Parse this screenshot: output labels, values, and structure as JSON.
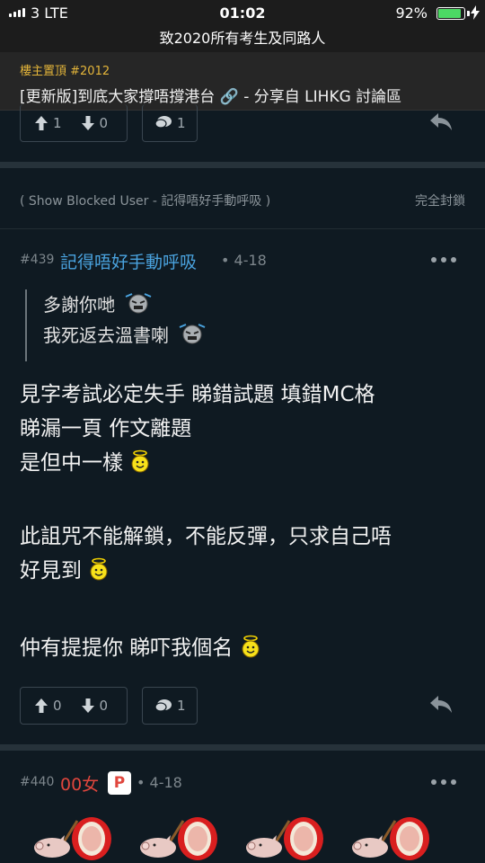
{
  "status": {
    "carrier": "3 LTE",
    "time": "01:02",
    "battery_pct": "92%",
    "battery_level": 0.92
  },
  "header": {
    "title": "致2020所有考生及同路人"
  },
  "pinned": {
    "tag": "樓主置頂 #2012",
    "title": "[更新版]到底大家撐唔撐港台 🔗 - 分享自 LIHKG 討論區"
  },
  "prev_post": {
    "upvotes": "1",
    "downvotes": "0",
    "replies": "1"
  },
  "blocked_bar": {
    "text": "( Show Blocked User - 記得唔好手動呼吸 )",
    "action": "完全封鎖"
  },
  "post439": {
    "number": "#439",
    "username": "記得唔好手動呼吸",
    "date": "• 4-18",
    "quote": [
      "多謝你哋",
      "我死返去溫書喇"
    ],
    "lines": [
      "見字考試必定失手 睇錯試題 填錯MC格",
      "睇漏一頁 作文離題",
      "是但中一樣",
      "此詛咒不能解鎖，不能反彈，只求自己唔",
      "好見到",
      "仲有提提你 睇吓我個名"
    ],
    "upvotes": "0",
    "downvotes": "0",
    "replies": "1"
  },
  "post440": {
    "number": "#440",
    "username": "00女",
    "badge": "P",
    "date": "• 4-18"
  },
  "icons": [
    "upvote-icon",
    "downvote-icon",
    "comment-icon",
    "share-icon",
    "more-icon",
    "angel-emoji",
    "angry-emoji",
    "pig-drum-emoji"
  ]
}
